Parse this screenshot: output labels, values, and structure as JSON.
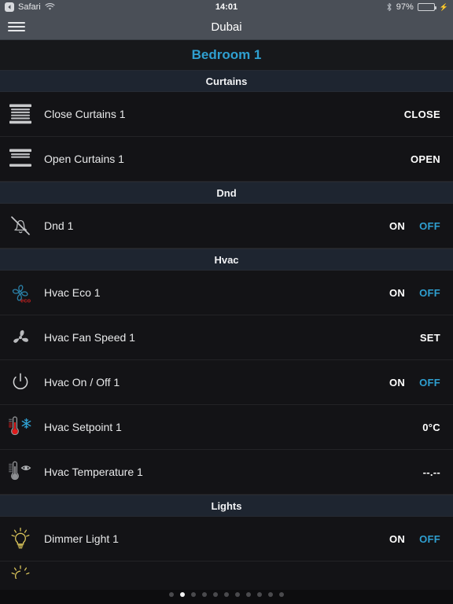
{
  "status_bar": {
    "back_app": "Safari",
    "back_icon": "back-arrow-icon",
    "wifi_icon": "wifi-icon",
    "time": "14:01",
    "bluetooth_icon": "bluetooth-icon",
    "battery_percent": "97%",
    "battery_icon": "battery-charging-icon",
    "battery_level": 97,
    "battery_color": "#4cd964"
  },
  "navbar": {
    "menu_icon": "hamburger-menu-icon",
    "title": "Dubai"
  },
  "room": {
    "title": "Bedroom 1",
    "title_color": "#2f9fd0"
  },
  "sections": [
    {
      "title": "Curtains",
      "rows": [
        {
          "icon": "blind-closed-icon",
          "label": "Close Curtains 1",
          "actions": [
            {
              "label": "CLOSE",
              "style": "plain"
            }
          ]
        },
        {
          "icon": "blind-open-icon",
          "label": "Open Curtains 1",
          "actions": [
            {
              "label": "OPEN",
              "style": "plain"
            }
          ]
        }
      ]
    },
    {
      "title": "Dnd",
      "rows": [
        {
          "icon": "bell-slash-icon",
          "label": "Dnd 1",
          "actions": [
            {
              "label": "ON",
              "style": "on"
            },
            {
              "label": "OFF",
              "style": "off"
            }
          ]
        }
      ]
    },
    {
      "title": "Hvac",
      "rows": [
        {
          "icon": "fan-eco-icon",
          "label": "Hvac Eco 1",
          "actions": [
            {
              "label": "ON",
              "style": "on"
            },
            {
              "label": "OFF",
              "style": "off"
            }
          ]
        },
        {
          "icon": "fan-speed-icon",
          "label": "Hvac Fan Speed 1",
          "actions": [
            {
              "label": "SET",
              "style": "plain"
            }
          ]
        },
        {
          "icon": "power-icon",
          "label": "Hvac On / Off 1",
          "actions": [
            {
              "label": "ON",
              "style": "on"
            },
            {
              "label": "OFF",
              "style": "off"
            }
          ]
        },
        {
          "icon": "thermometer-snowflake-icon",
          "label": "Hvac Setpoint 1",
          "actions": [
            {
              "label": "0°C",
              "style": "value"
            }
          ]
        },
        {
          "icon": "thermometer-eye-icon",
          "label": "Hvac Temperature 1",
          "actions": [
            {
              "label": "--.--",
              "style": "value"
            }
          ]
        }
      ]
    },
    {
      "title": "Lights",
      "rows": [
        {
          "icon": "lightbulb-icon",
          "label": "Dimmer Light 1",
          "actions": [
            {
              "label": "ON",
              "style": "on"
            },
            {
              "label": "OFF",
              "style": "off"
            }
          ]
        },
        {
          "icon": "lightbulb-icon",
          "label": "",
          "actions": [],
          "partial": true
        }
      ]
    }
  ],
  "pagination": {
    "total": 11,
    "active_index": 1
  },
  "colors": {
    "accent": "#2f9fd0",
    "eco_text": "#c02020",
    "bulb": "#d9c45a",
    "snowflake": "#2f9fd0",
    "mercury": "#e01b1b"
  }
}
